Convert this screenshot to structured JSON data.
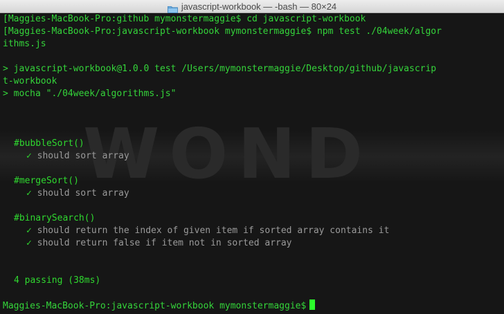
{
  "window": {
    "title": "javascript-workbook — -bash — 80×24"
  },
  "terminal": {
    "line1": "[Maggies-MacBook-Pro:github mymonstermaggie$ cd javascript-workbook",
    "line2": "[Maggies-MacBook-Pro:javascript-workbook mymonstermaggie$ npm test ./04week/algor",
    "line3": "ithms.js",
    "line4": "> javascript-workbook@1.0.0 test /Users/mymonstermaggie/Desktop/github/javascrip",
    "line5": "t-workbook",
    "line6": "> mocha \"./04week/algorithms.js\"",
    "suites": [
      {
        "name": "#bubbleSort()",
        "tests": [
          "should sort array"
        ]
      },
      {
        "name": "#mergeSort()",
        "tests": [
          "should sort array"
        ]
      },
      {
        "name": "#binarySearch()",
        "tests": [
          "should return the index of given item if sorted array contains it",
          "should return false if item not in sorted array"
        ]
      }
    ],
    "check_glyph": "✓",
    "summary": "4 passing (38ms)",
    "prompt": "Maggies-MacBook-Pro:javascript-workbook mymonstermaggie$",
    "bg_watermark_text": "WOND"
  },
  "colors": {
    "text_green": "#2fd82f",
    "text_gray": "#9a9a9a",
    "background": "#161616",
    "cursor": "#2bff2b"
  }
}
